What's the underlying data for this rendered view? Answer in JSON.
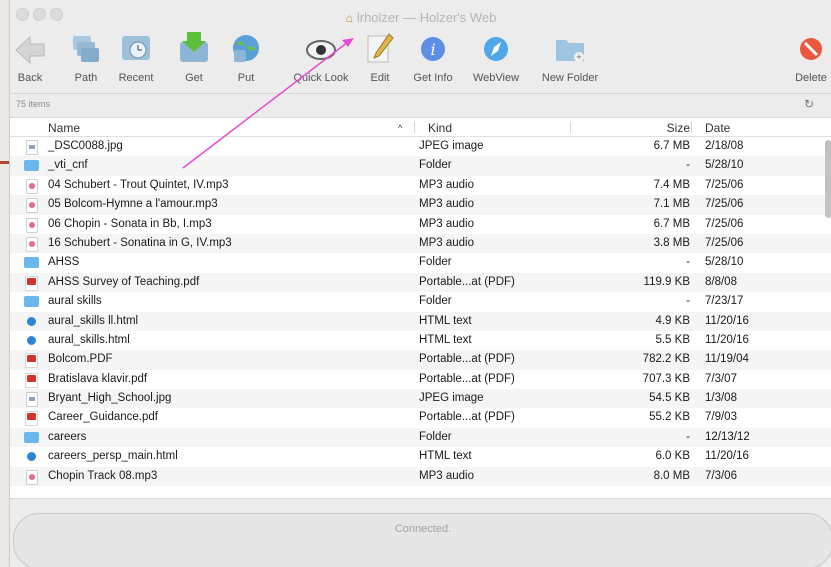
{
  "window": {
    "title": "lrholzer — Holzer's Web",
    "title_icon": "house-icon",
    "item_count": "75 items",
    "refresh_icon": "refresh-icon",
    "connection_status": "Connected."
  },
  "toolbar": [
    {
      "label": "Back",
      "icon": "back-arrow-icon"
    },
    {
      "label": "Path",
      "icon": "path-icon"
    },
    {
      "label": "Recent",
      "icon": "recent-icon"
    },
    {
      "label": "Get",
      "icon": "get-download-icon"
    },
    {
      "label": "Put",
      "icon": "put-upload-icon"
    },
    {
      "label": "Quick Look",
      "icon": "eye-icon"
    },
    {
      "label": "Edit",
      "icon": "edit-pencil-icon"
    },
    {
      "label": "Get Info",
      "icon": "info-icon"
    },
    {
      "label": "WebView",
      "icon": "compass-icon"
    },
    {
      "label": "New Folder",
      "icon": "new-folder-icon"
    },
    {
      "label": "Delete",
      "icon": "delete-icon"
    }
  ],
  "columns": {
    "name": "Name",
    "kind": "Kind",
    "size": "Size",
    "date": "Date",
    "sort_indicator": "^"
  },
  "files": [
    {
      "name": "_DSC0088.jpg",
      "kind": "JPEG image",
      "size": "6.7 MB",
      "date": "2/18/08",
      "type": "jpg"
    },
    {
      "name": "_vti_cnf",
      "kind": "Folder",
      "size": "-",
      "date": "5/28/10",
      "type": "folder"
    },
    {
      "name": "04 Schubert - Trout Quintet, IV.mp3",
      "kind": "MP3 audio",
      "size": "7.4 MB",
      "date": "7/25/06",
      "type": "mp3"
    },
    {
      "name": "05 Bolcom-Hymne a l'amour.mp3",
      "kind": "MP3 audio",
      "size": "7.1 MB",
      "date": "7/25/06",
      "type": "mp3"
    },
    {
      "name": "06 Chopin - Sonata in Bb, I.mp3",
      "kind": "MP3 audio",
      "size": "6.7 MB",
      "date": "7/25/06",
      "type": "mp3"
    },
    {
      "name": "16 Schubert - Sonatina in G, IV.mp3",
      "kind": "MP3 audio",
      "size": "3.8 MB",
      "date": "7/25/06",
      "type": "mp3"
    },
    {
      "name": "AHSS",
      "kind": "Folder",
      "size": "-",
      "date": "5/28/10",
      "type": "folder"
    },
    {
      "name": "AHSS Survey of Teaching.pdf",
      "kind": "Portable...at (PDF)",
      "size": "119.9 KB",
      "date": "8/8/08",
      "type": "pdf"
    },
    {
      "name": "aural skills",
      "kind": "Folder",
      "size": "-",
      "date": "7/23/17",
      "type": "folder"
    },
    {
      "name": "aural_skills ll.html",
      "kind": "HTML text",
      "size": "4.9 KB",
      "date": "11/20/16",
      "type": "html"
    },
    {
      "name": "aural_skills.html",
      "kind": "HTML text",
      "size": "5.5 KB",
      "date": "11/20/16",
      "type": "html"
    },
    {
      "name": "Bolcom.PDF",
      "kind": "Portable...at (PDF)",
      "size": "782.2 KB",
      "date": "11/19/04",
      "type": "pdf"
    },
    {
      "name": "Bratislava klavir.pdf",
      "kind": "Portable...at (PDF)",
      "size": "707.3 KB",
      "date": "7/3/07",
      "type": "pdf"
    },
    {
      "name": "Bryant_High_School.jpg",
      "kind": "JPEG image",
      "size": "54.5 KB",
      "date": "1/3/08",
      "type": "jpg"
    },
    {
      "name": "Career_Guidance.pdf",
      "kind": "Portable...at (PDF)",
      "size": "55.2 KB",
      "date": "7/9/03",
      "type": "pdf"
    },
    {
      "name": "careers",
      "kind": "Folder",
      "size": "-",
      "date": "12/13/12",
      "type": "folder"
    },
    {
      "name": "careers_persp_main.html",
      "kind": "HTML text",
      "size": "6.0 KB",
      "date": "11/20/16",
      "type": "html"
    },
    {
      "name": "Chopin Track 08.mp3",
      "kind": "MP3 audio",
      "size": "8.0 MB",
      "date": "7/3/06",
      "type": "mp3"
    }
  ],
  "annotation_color": "#e64ad6"
}
